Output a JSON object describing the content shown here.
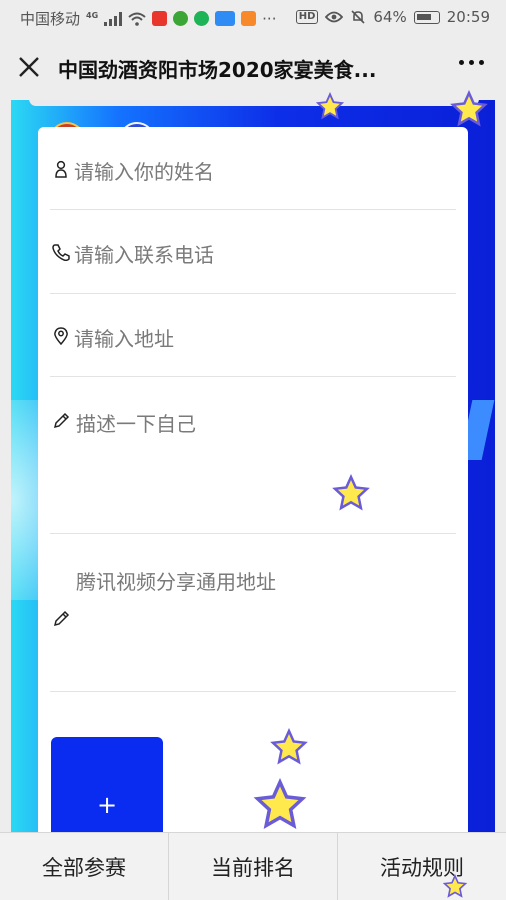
{
  "status_bar": {
    "carrier": "中国移动",
    "network": "4G",
    "battery": "64%",
    "time": "20:59",
    "hd_badge": "HD",
    "overflow": "···"
  },
  "header": {
    "title": "中国劲酒资阳市场2020家宴美食..."
  },
  "form": {
    "name_placeholder": "请输入你的姓名",
    "phone_placeholder": "请输入联系电话",
    "address_placeholder": "请输入地址",
    "describe_placeholder": "描述一下自己",
    "video_placeholder": "腾讯视频分享通用地址",
    "upload_plus": "+"
  },
  "bottom_nav": {
    "all_entries": "全部参赛",
    "current_rank": "当前排名",
    "rules": "活动规则"
  },
  "colors": {
    "card": "#ffffff",
    "poster_blue": "#0a1fd8",
    "poster_cyan": "#2bd9f3",
    "upload_blue": "#0a2bf0",
    "star_yellow": "#ffe94d",
    "star_outline": "#6a5bd6"
  }
}
